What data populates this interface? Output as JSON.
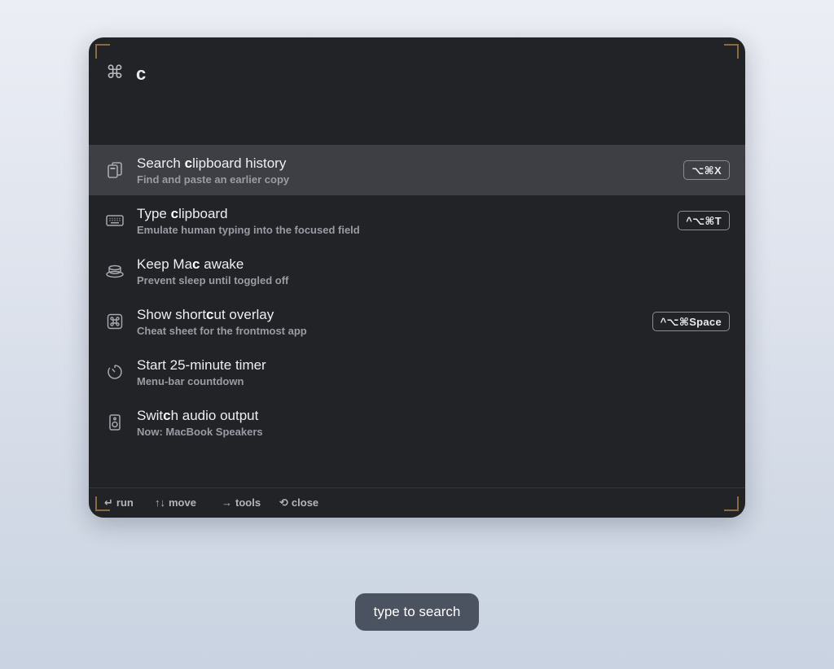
{
  "search": {
    "icon": "command-icon",
    "query": "c"
  },
  "results": [
    {
      "icon": "clipboard-icon",
      "title_before": "Search ",
      "title_match": "c",
      "title_after": "lipboard history",
      "subtitle": "Find and paste an earlier copy",
      "shortcut": "⌥⌘X",
      "selected": true
    },
    {
      "icon": "keyboard-icon",
      "title_before": "Type ",
      "title_match": "c",
      "title_after": "lipboard",
      "subtitle": "Emulate human typing into the focused field",
      "shortcut": "^⌥⌘T",
      "selected": false
    },
    {
      "icon": "coffee-cup-icon",
      "title_before": "Keep Ma",
      "title_match": "c",
      "title_after": " awake",
      "subtitle": "Prevent sleep until toggled off",
      "shortcut": "",
      "selected": false
    },
    {
      "icon": "command-key-icon",
      "title_before": "Show short",
      "title_match": "c",
      "title_after": "ut overlay",
      "subtitle": "Cheat sheet for the frontmost app",
      "shortcut": "^⌥⌘Space",
      "selected": false
    },
    {
      "icon": "timer-icon",
      "title_before": "Start 25-minute timer",
      "title_match": "",
      "title_after": "",
      "subtitle": "Menu-bar countdown",
      "shortcut": "",
      "selected": false
    },
    {
      "icon": "speaker-icon",
      "title_before": "Swit",
      "title_match": "c",
      "title_after": "h audio output",
      "subtitle": "Now: MacBook Speakers",
      "shortcut": "",
      "selected": false
    }
  ],
  "footer": {
    "run": {
      "glyph": "↵",
      "label": "run"
    },
    "move": {
      "glyph": "↑↓",
      "label": "move"
    },
    "tools": {
      "glyph": "→",
      "label": "tools"
    },
    "close": {
      "glyph": "⟲",
      "label": "close"
    }
  },
  "toast": {
    "text": "type to search"
  },
  "colors": {
    "panel_bg": "#222327",
    "selected_row": "#3e3f44",
    "corner_accent": "#8c6a3e",
    "toast_bg": "#4b5260"
  }
}
